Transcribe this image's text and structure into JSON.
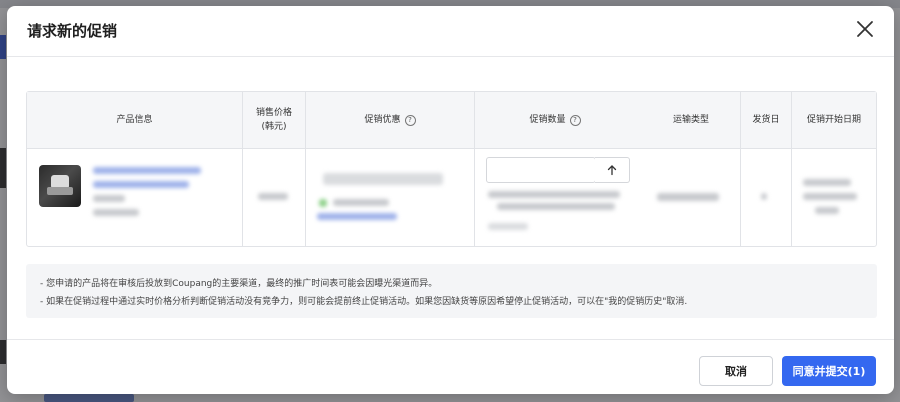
{
  "modal": {
    "title": "请求新的促销",
    "close_icon": "close-icon"
  },
  "table": {
    "headers": {
      "product_info": "产品信息",
      "sale_price": "销售价格",
      "sale_price_unit": "(韩元)",
      "promo_discount": "促销优惠",
      "promo_quantity": "促销数量",
      "shipping_type": "运输类型",
      "ship_day": "发货日",
      "promo_start_date": "促销开始日期"
    },
    "help_icon": "question-circle-icon",
    "row": {
      "quantity_value": "",
      "up_icon": "arrow-up-icon"
    }
  },
  "notice": {
    "line1": "- 您申请的产品将在审核后投放到Coupang的主要渠道，最终的推广时间表可能会因曝光渠道而异。",
    "line2": "- 如果在促销过程中通过实时价格分析判断促销活动没有竞争力，则可能会提前终止促销活动。如果您因缺货等原因希望停止促销活动，可以在\"我的促销历史\"取消."
  },
  "footer": {
    "cancel_label": "取消",
    "submit_label": "同意并提交(1)"
  },
  "colors": {
    "primary": "#3468f0",
    "overlay": "#1e2024"
  }
}
